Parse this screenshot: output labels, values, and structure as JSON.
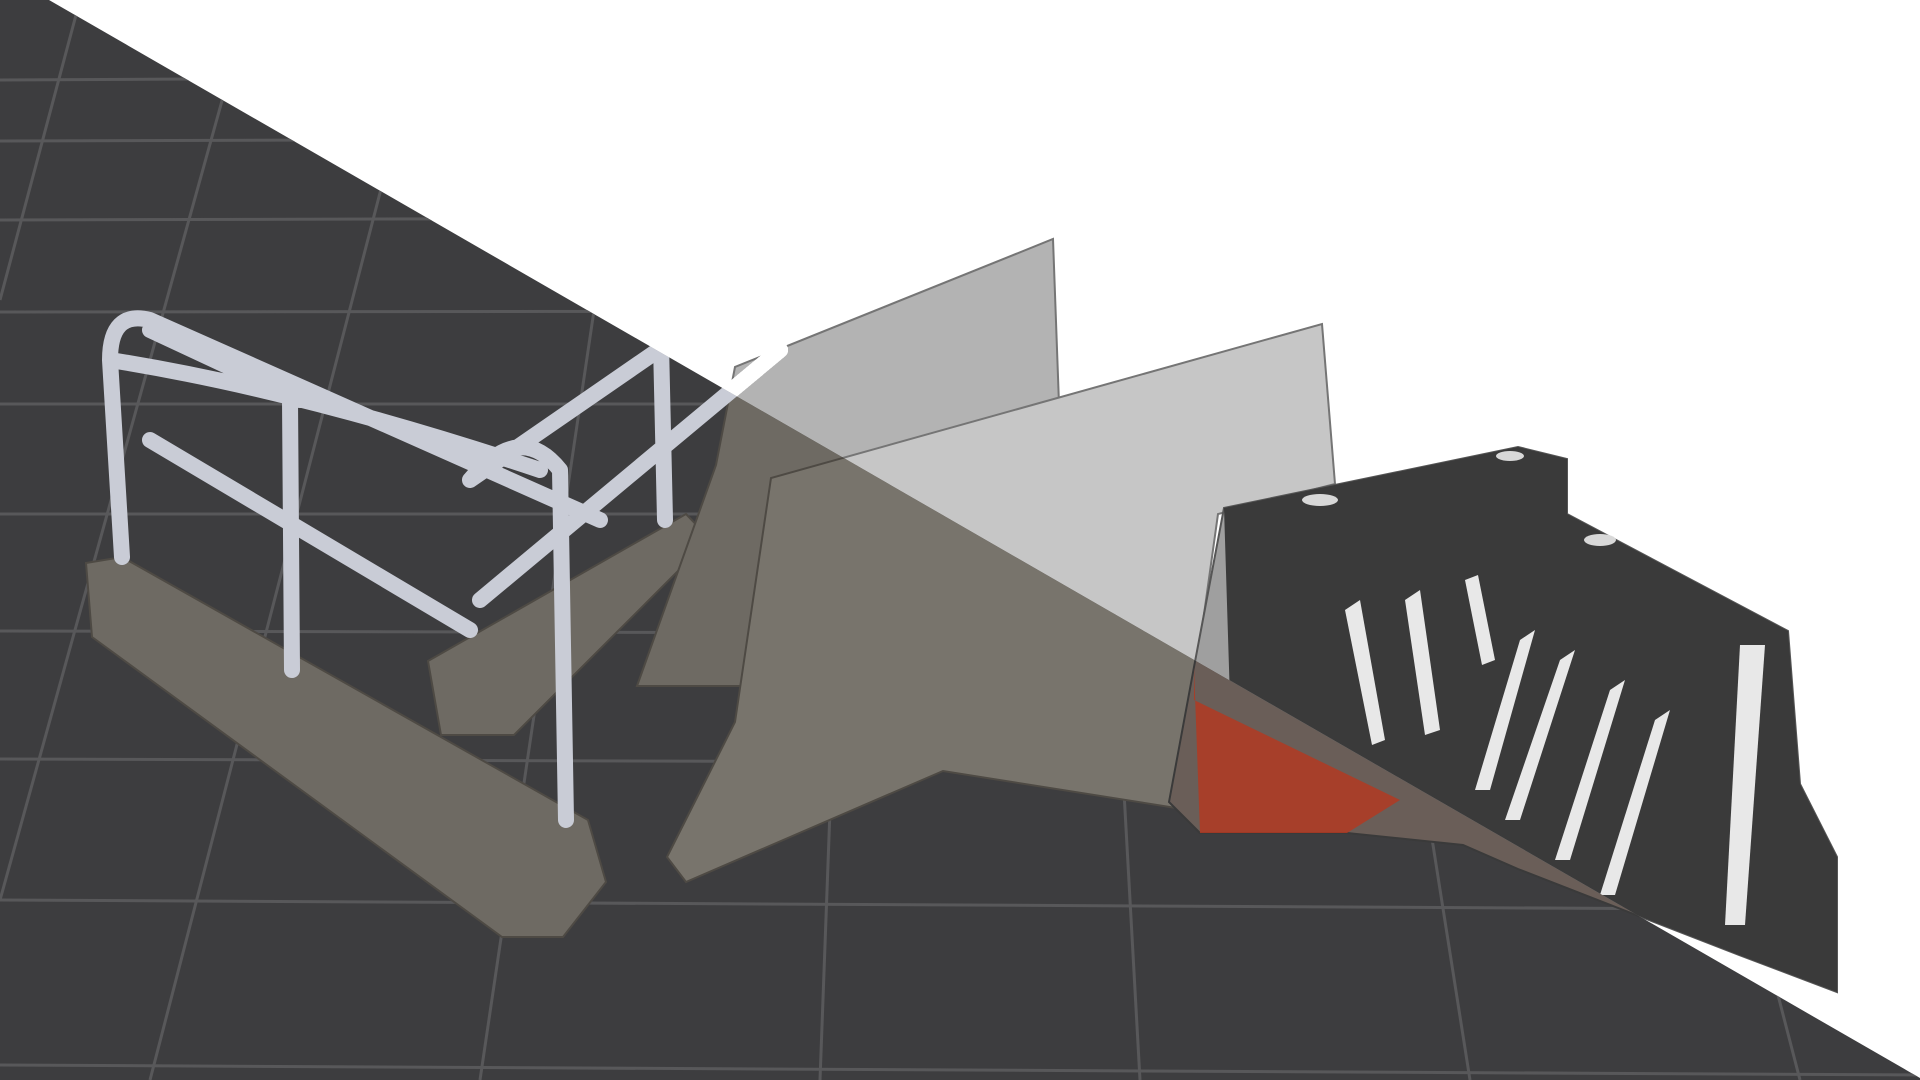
{
  "scene": {
    "subject": "barriers-render",
    "colors": {
      "backdrop_dark": "#3d3d3f",
      "grid_line": "#5a5a5c",
      "backdrop_light": "#ffffff",
      "concrete": "#77736c",
      "concrete_shadow": "#5e5a54",
      "rail": "#c9ccd6",
      "plastic_dark": "#3b3b3b",
      "plastic_red": "#b23a22"
    }
  }
}
